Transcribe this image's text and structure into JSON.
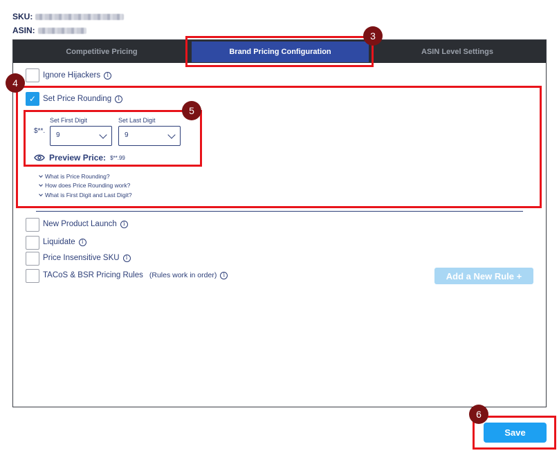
{
  "product": {
    "sku_label": "SKU:",
    "asin_label": "ASIN:"
  },
  "tabs": [
    {
      "label": "Competitive Pricing",
      "active": false
    },
    {
      "label": "Brand Pricing Configuration",
      "active": true
    },
    {
      "label": "ASIN Level Settings",
      "active": false
    }
  ],
  "options": {
    "ignore_hijackers": {
      "label": "Ignore Hijackers",
      "checked": false
    },
    "price_rounding": {
      "label": "Set Price Rounding",
      "checked": true,
      "prefix": "$**.",
      "first_digit_label": "Set First Digit",
      "first_digit_value": "9",
      "last_digit_label": "Set Last Digit",
      "last_digit_value": "9",
      "preview_label": "Preview Price:",
      "preview_value": "$**.99",
      "faq": [
        "What is Price Rounding?",
        "How does Price Rounding work?",
        "What is First Digit and Last Digit?"
      ]
    },
    "new_product_launch": {
      "label": "New Product Launch",
      "checked": false
    },
    "liquidate": {
      "label": "Liquidate",
      "checked": false
    },
    "price_insensitive": {
      "label": "Price Insensitive SKU",
      "checked": false
    },
    "tacos_bsr": {
      "label": "TACoS & BSR Pricing Rules",
      "note": "(Rules work in order)",
      "checked": false
    }
  },
  "add_rule_label": "Add a New Rule +",
  "save_label": "Save",
  "info_glyph": "i",
  "check_glyph": "✓",
  "markers": [
    "3",
    "4",
    "5",
    "6"
  ],
  "colors": {
    "accent": "#1da0f2",
    "active_tab": "#2f4aa3",
    "tab_bar": "#2b2e33",
    "annotation": "#e8141b",
    "marker": "#7a1214"
  }
}
